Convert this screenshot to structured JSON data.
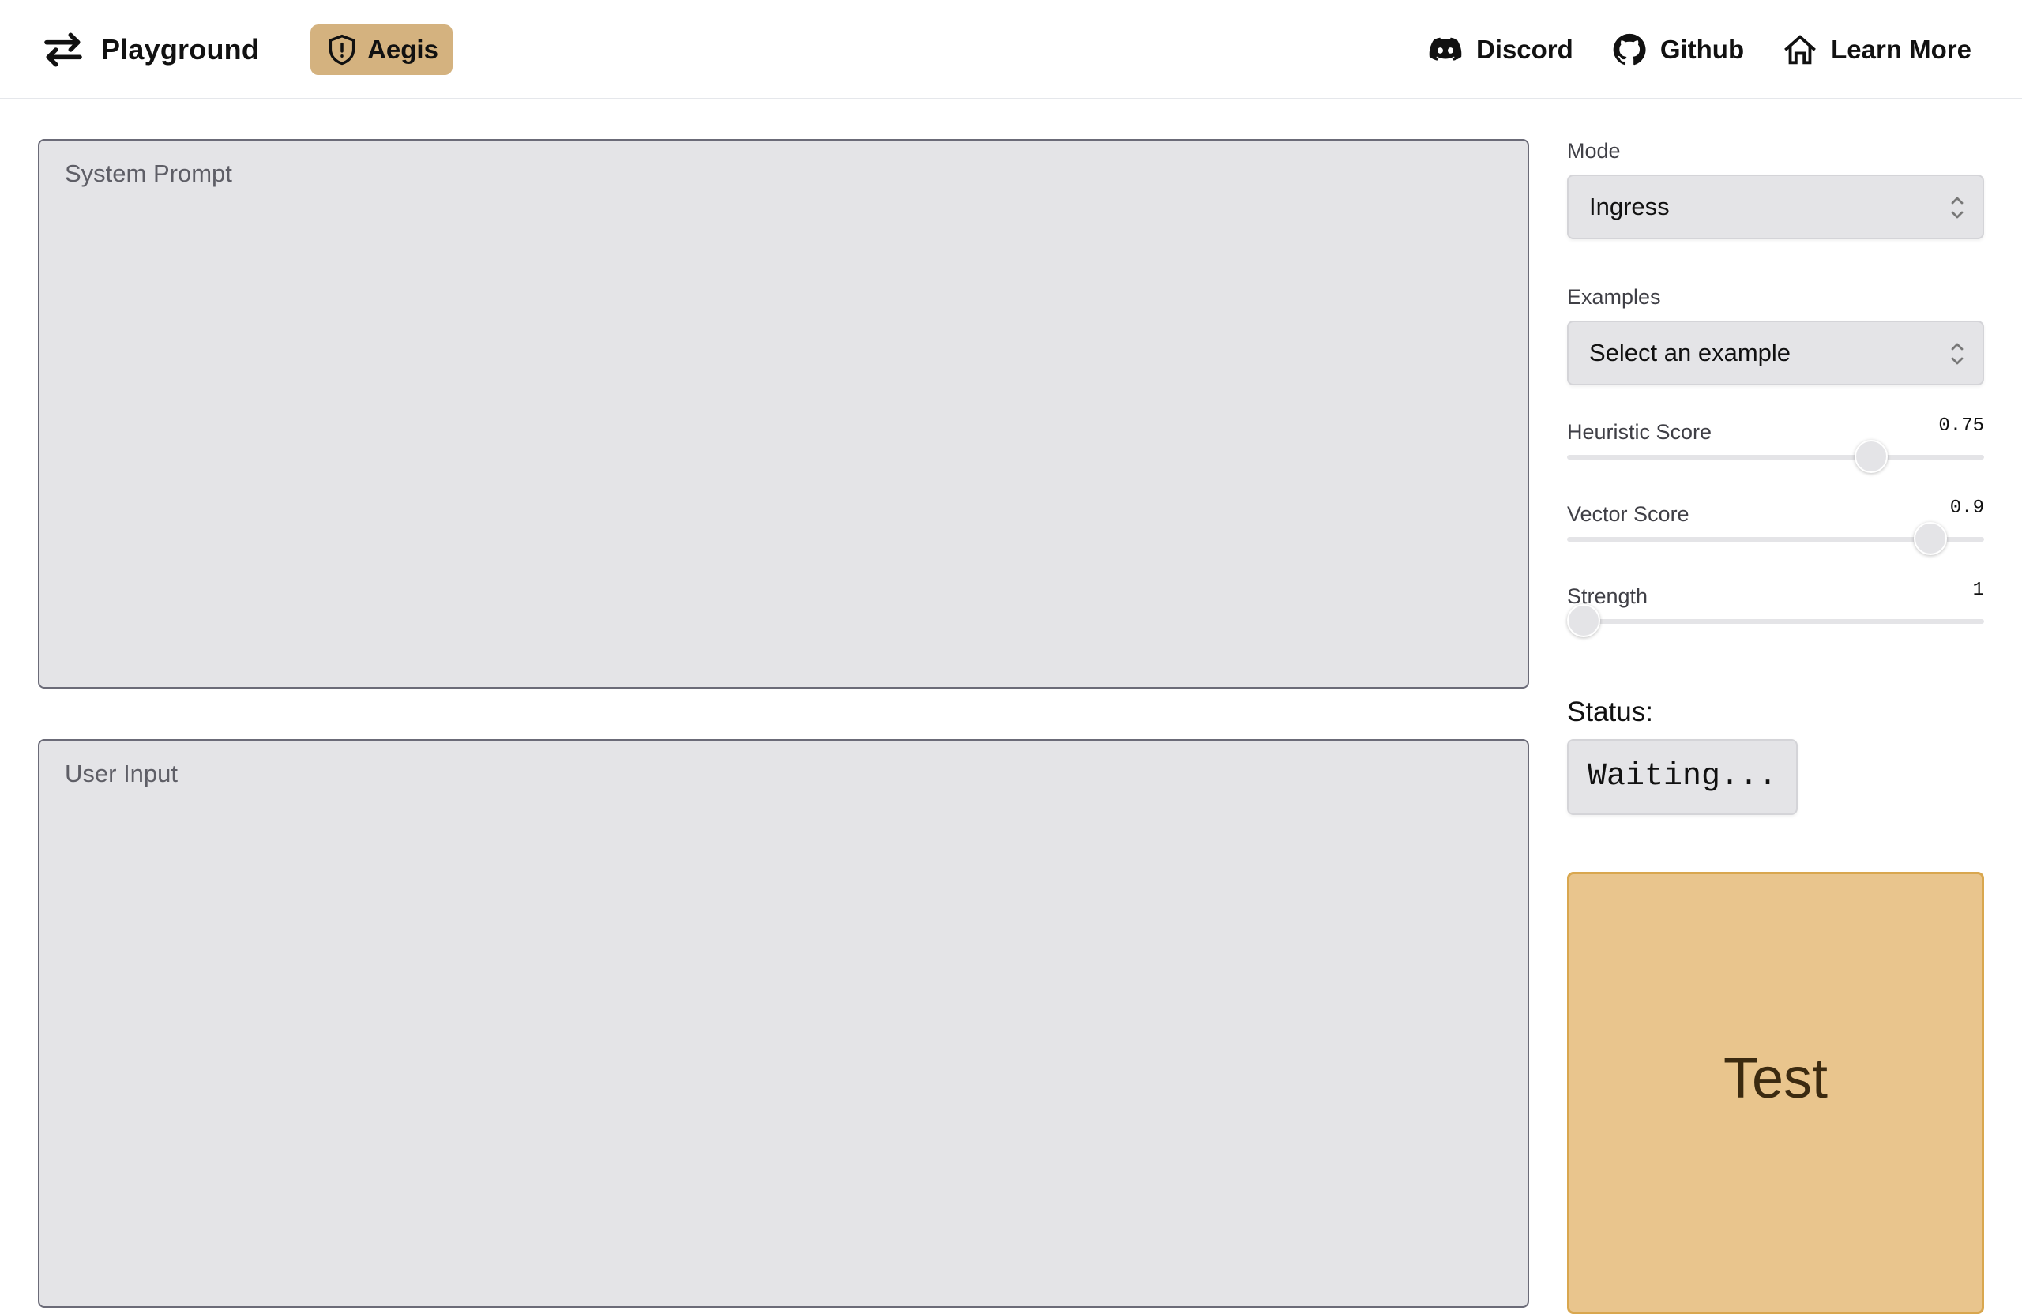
{
  "navbar": {
    "brand_label": "Playground",
    "brand_icon": "swap-arrows-icon",
    "product_label": "Aegis",
    "product_icon": "shield-alert-icon",
    "links": [
      {
        "label": "Discord",
        "icon": "discord-icon"
      },
      {
        "label": "Github",
        "icon": "github-icon"
      },
      {
        "label": "Learn More",
        "icon": "home-icon"
      }
    ]
  },
  "editor": {
    "system_prompt_placeholder": "System Prompt",
    "user_input_placeholder": "User Input"
  },
  "controls": {
    "mode": {
      "label": "Mode",
      "value": "Ingress"
    },
    "examples": {
      "label": "Examples",
      "value": "Select an example"
    },
    "heuristic": {
      "label": "Heuristic Score",
      "display": "0.75",
      "fraction": 0.73
    },
    "vector": {
      "label": "Vector Score",
      "display": "0.9",
      "fraction": 0.872
    },
    "strength": {
      "label": "Strength",
      "display": "1",
      "fraction": 0.04
    }
  },
  "status": {
    "label": "Status:",
    "value": "Waiting..."
  },
  "test_button_label": "Test",
  "colors": {
    "accent": "#d4b27f",
    "button_fill": "#e9c58d",
    "button_border": "#d9a74f",
    "field_fill": "#e4e4e7"
  }
}
